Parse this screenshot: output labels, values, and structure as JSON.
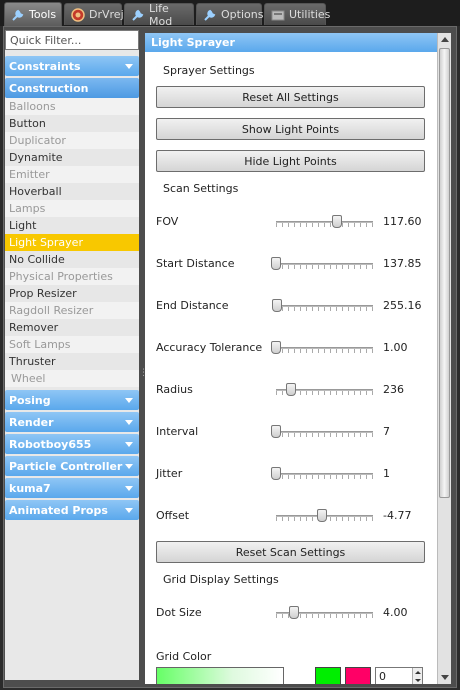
{
  "tabs": [
    {
      "label": "Tools",
      "icon": "wrench-icon",
      "active": true
    },
    {
      "label": "DrVrej",
      "icon": "drvrej-logo-icon",
      "active": false
    },
    {
      "label": "Life Mod",
      "icon": "wrench-icon",
      "active": false
    },
    {
      "label": "Options",
      "icon": "wrench-icon",
      "active": false
    },
    {
      "label": "Utilities",
      "icon": "utilities-icon",
      "active": false
    }
  ],
  "filter": {
    "placeholder": "Quick Filter..."
  },
  "categories": {
    "constraints": "Constraints",
    "construction": "Construction",
    "posing": "Posing",
    "render": "Render",
    "robotboy": "Robotboy655",
    "particle": "Particle Controller",
    "kuma": "kuma7",
    "animated": "Animated Props"
  },
  "construction_items": [
    "Balloons",
    "Button",
    "Duplicator",
    "Dynamite",
    "Emitter",
    "Hoverball",
    "Lamps",
    "Light",
    "Light Sprayer",
    "No Collide",
    "Physical Properties",
    "Prop Resizer",
    "Ragdoll Resizer",
    "Remover",
    "Soft Lamps",
    "Thruster",
    "Wheel"
  ],
  "panel": {
    "title": "Light Sprayer",
    "sprayer_settings": "Sprayer Settings",
    "reset_all": "Reset All Settings",
    "show_points": "Show Light Points",
    "hide_points": "Hide Light Points",
    "scan_settings": "Scan Settings",
    "reset_scan": "Reset Scan Settings",
    "grid_display_settings": "Grid Display Settings",
    "grid_color": "Grid Color",
    "grid_color_value": "0",
    "colors": {
      "gradient_start": "#66ff66",
      "swatch_green": "#00ee00",
      "swatch_red": "#ff0066",
      "accent": "#5aa8ec",
      "selected": "#f8c800"
    }
  },
  "sliders": [
    {
      "label": "FOV",
      "value": "117.60",
      "level": 0.63
    },
    {
      "label": "Start Distance",
      "value": "137.85",
      "level": 0.0
    },
    {
      "label": "End Distance",
      "value": "255.16",
      "level": 0.01
    },
    {
      "label": "Accuracy Tolerance",
      "value": "1.00",
      "level": 0.0
    },
    {
      "label": "Radius",
      "value": "236",
      "level": 0.15
    },
    {
      "label": "Interval",
      "value": "7",
      "level": 0.0
    },
    {
      "label": "Jitter",
      "value": "1",
      "level": 0.0
    },
    {
      "label": "Offset",
      "value": "-4.77",
      "level": 0.47
    },
    {
      "label": "Dot Size",
      "value": "4.00",
      "level": 0.19
    }
  ]
}
